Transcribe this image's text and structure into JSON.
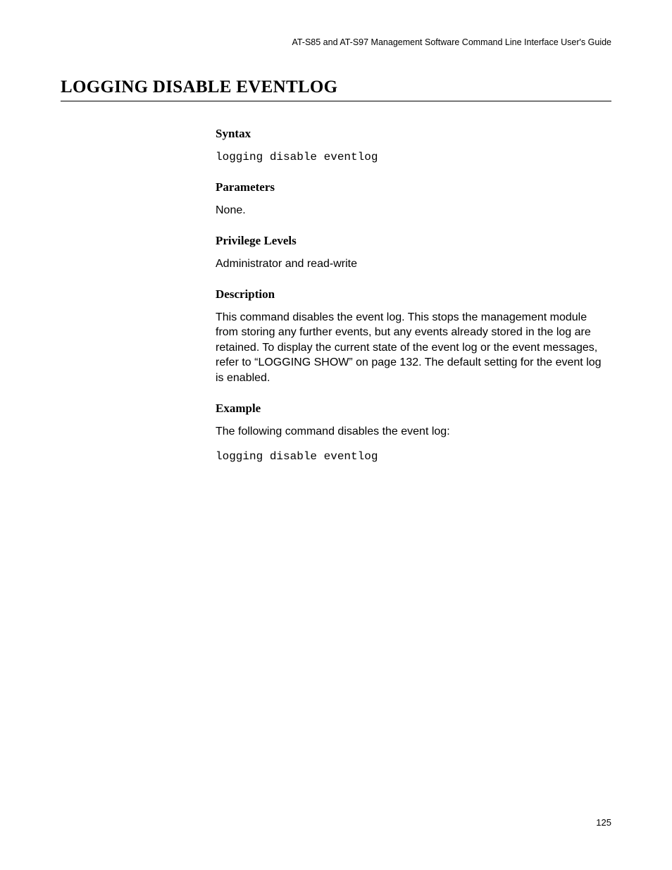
{
  "header": "AT-S85 and AT-S97 Management Software Command Line Interface User's Guide",
  "title": "LOGGING DISABLE EVENTLOG",
  "sections": {
    "syntax": {
      "heading": "Syntax",
      "code": "logging disable eventlog"
    },
    "parameters": {
      "heading": "Parameters",
      "text": "None."
    },
    "privilege": {
      "heading": "Privilege Levels",
      "text": "Administrator and read-write"
    },
    "description": {
      "heading": "Description",
      "text": "This command disables the event log. This stops the management module from storing any further events, but any events already stored in the log are retained. To display the current state of the event log or the event messages, refer to “LOGGING SHOW” on page 132. The default setting for the event log is enabled."
    },
    "example": {
      "heading": "Example",
      "text": "The following command disables the event log:",
      "code": "logging disable eventlog"
    }
  },
  "pageNumber": "125"
}
